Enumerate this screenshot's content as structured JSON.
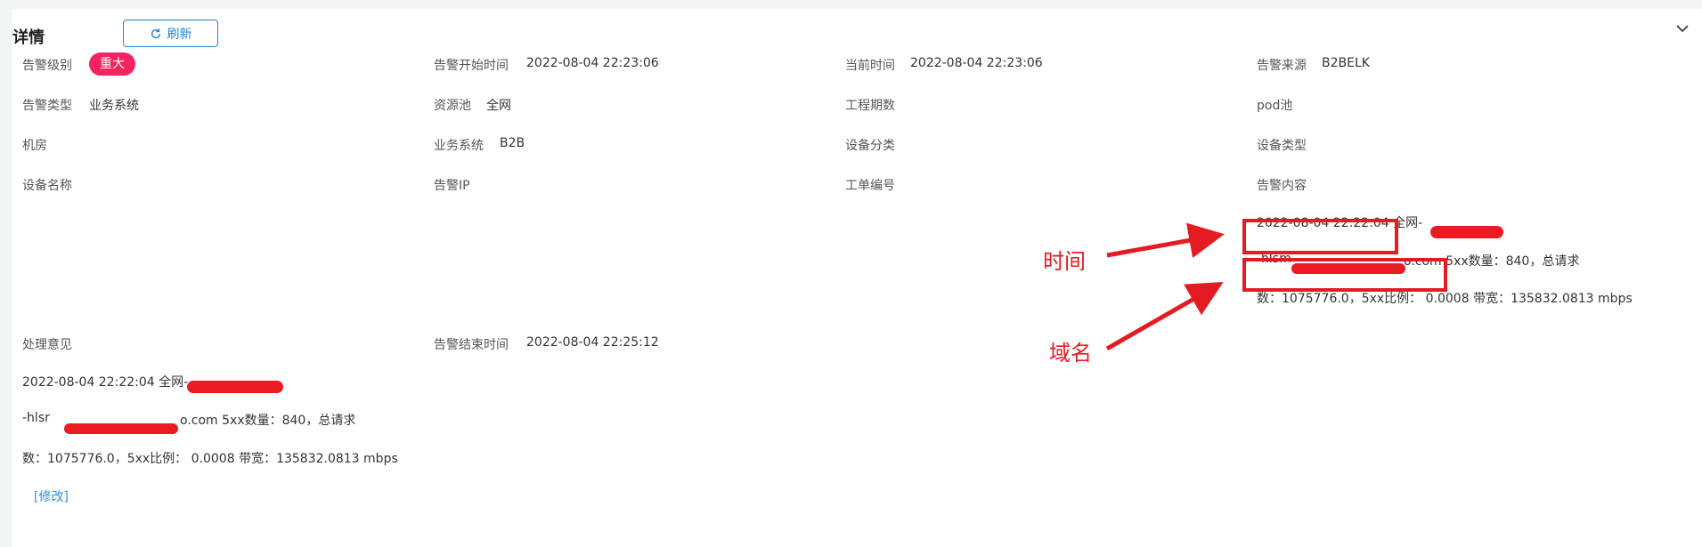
{
  "panel": {
    "title": "详情",
    "refresh_label": "刷新",
    "collapse_icon": "chevron-down-icon"
  },
  "fields": {
    "alarm_level": {
      "label": "告警级别",
      "value": "重大"
    },
    "alarm_start_time": {
      "label": "告警开始时间",
      "value": "2022-08-04 22:23:06"
    },
    "current_time": {
      "label": "当前时间",
      "value": "2022-08-04 22:23:06"
    },
    "alarm_source": {
      "label": "告警来源",
      "value": "B2BELK"
    },
    "alarm_type": {
      "label": "告警类型",
      "value": "业务系统"
    },
    "resource_pool": {
      "label": "资源池",
      "value": "全网"
    },
    "project_phase": {
      "label": "工程期数",
      "value": ""
    },
    "pod_pool": {
      "label": "pod池",
      "value": ""
    },
    "machine_room": {
      "label": "机房",
      "value": ""
    },
    "business_system": {
      "label": "业务系统",
      "value": "B2B"
    },
    "device_category": {
      "label": "设备分类",
      "value": ""
    },
    "device_type": {
      "label": "设备类型",
      "value": ""
    },
    "device_name": {
      "label": "设备名称",
      "value": ""
    },
    "alarm_ip": {
      "label": "告警IP",
      "value": ""
    },
    "ticket_number": {
      "label": "工单编号",
      "value": ""
    },
    "alarm_content": {
      "label": "告警内容",
      "line1": "2022-08-04 22:22:04 全网-",
      "line2a": "-hlsm",
      "line2b": "o.com 5xx数量：840，总请求",
      "line3": "数：1075776.0，5xx比例： 0.0008 带宽：135832.0813 mbps"
    },
    "handling_opinion": {
      "label": "处理意见",
      "line1": "2022-08-04 22:22:04 全网-",
      "line2a": "-hlsr",
      "line2b": "o.com 5xx数量：840，总请求",
      "line3": "数：1075776.0，5xx比例： 0.0008 带宽：135832.0813 mbps",
      "edit_link": "[修改]"
    },
    "alarm_end_time": {
      "label": "告警结束时间",
      "value": "2022-08-04 22:25:12"
    }
  },
  "annotations": {
    "time_label": "时间",
    "domain_label": "域名"
  },
  "colors": {
    "accent": "#1f86d3",
    "badge_major": "#f3245f",
    "annotation_red": "#e41b23"
  }
}
